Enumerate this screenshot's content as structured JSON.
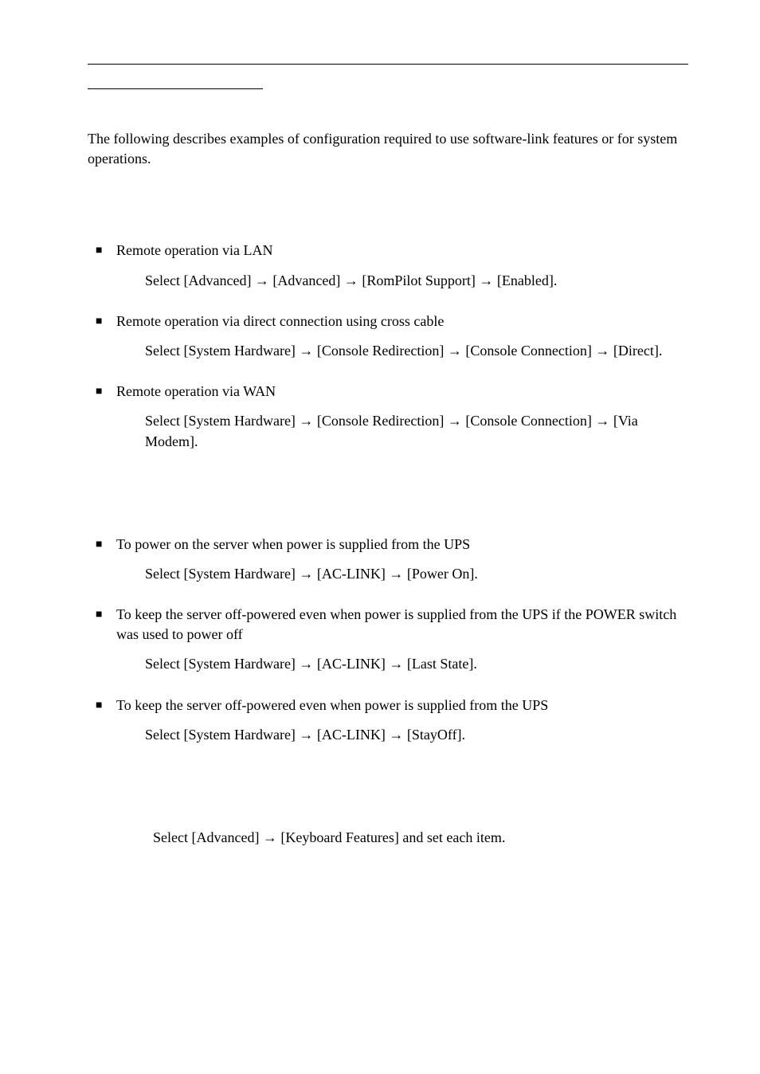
{
  "intro": "The following describes examples of configuration required to use software-link features or for system operations.",
  "section1": {
    "items": [
      {
        "lead": "Remote operation via LAN",
        "sub": "Select [Advanced] → [Advanced] → [RomPilot Support] → [Enabled]."
      },
      {
        "lead": "Remote operation via direct connection using cross cable",
        "sub": "Select [System Hardware] → [Console Redirection] → [Console Connection] → [Direct]."
      },
      {
        "lead": "Remote operation via WAN",
        "sub": "Select [System Hardware] → [Console Redirection] → [Console Connection] → [Via Modem]."
      }
    ]
  },
  "section2": {
    "items": [
      {
        "lead": "To power on the server when power is supplied from the UPS",
        "sub": "Select [System Hardware] → [AC-LINK] → [Power On]."
      },
      {
        "lead": "To keep the server off-powered even when power is supplied from the UPS if the POWER switch was used to power off",
        "sub": "Select [System Hardware] → [AC-LINK] → [Last State]."
      },
      {
        "lead": "To keep the server off-powered even when power is supplied from the UPS",
        "sub": "Select [System Hardware] → [AC-LINK] → [StayOff]."
      }
    ]
  },
  "section3": {
    "sub": "Select [Advanced] → [Keyboard Features] and set each item."
  },
  "bullet": "■"
}
